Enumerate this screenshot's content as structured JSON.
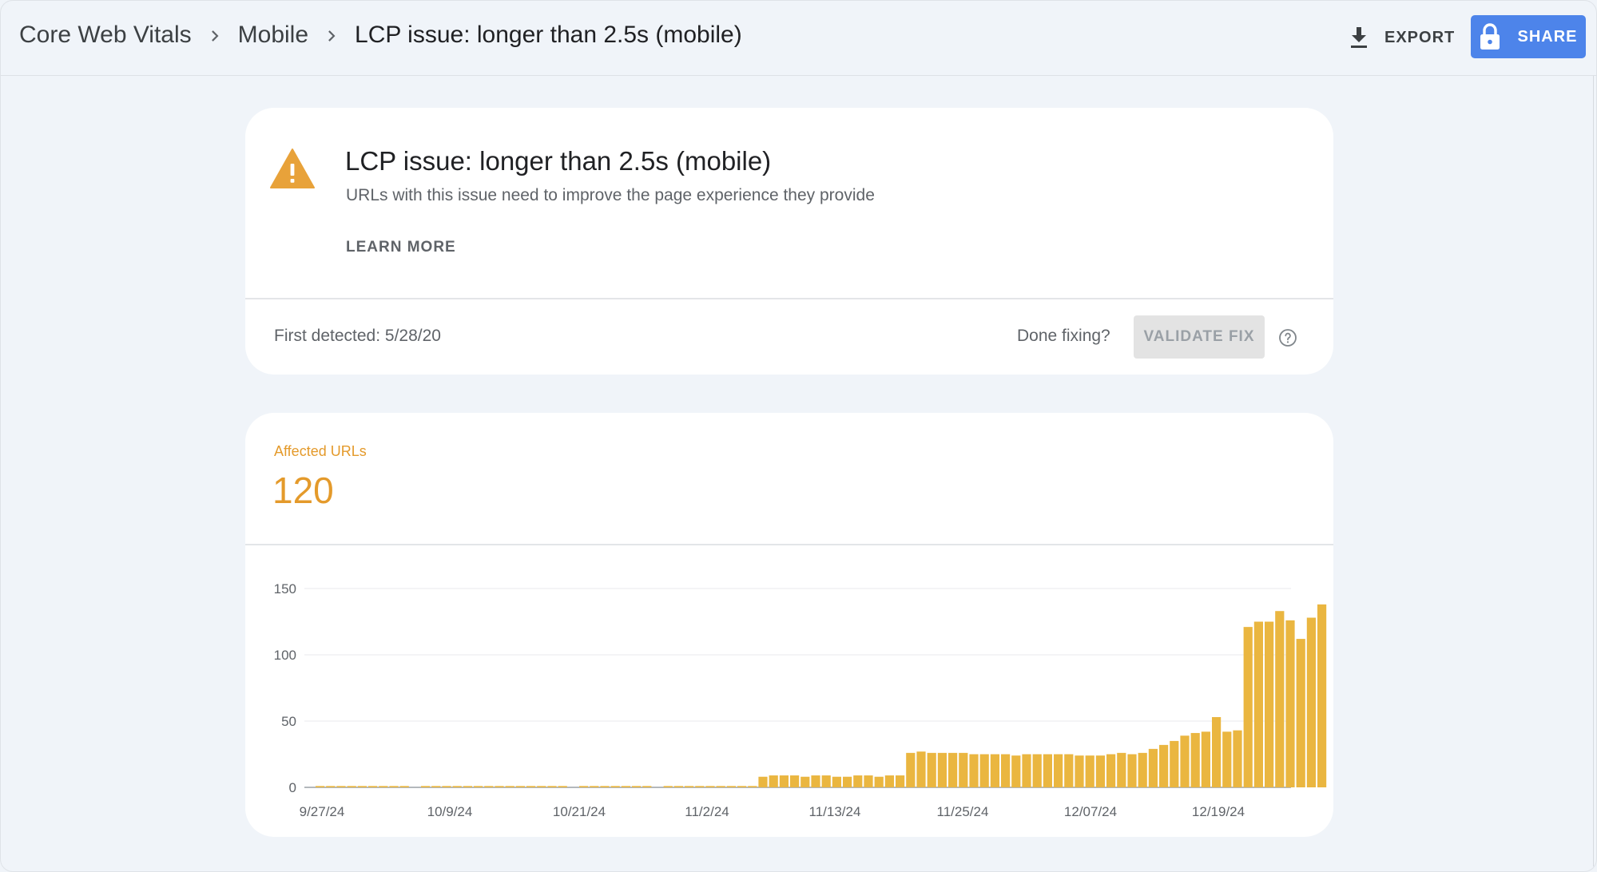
{
  "breadcrumbs": [
    "Core Web Vitals",
    "Mobile",
    "LCP issue: longer than 2.5s (mobile)"
  ],
  "toolbar": {
    "export_label": "EXPORT",
    "share_label": "SHARE"
  },
  "issue": {
    "title": "LCP issue: longer than 2.5s (mobile)",
    "description": "URLs with this issue need to improve the page experience they provide",
    "learn_more_label": "LEARN MORE",
    "first_detected": "First detected: 5/28/20",
    "done_fixing_label": "Done fixing?",
    "validate_fix_label": "VALIDATE FIX"
  },
  "summary": {
    "label": "Affected URLs",
    "value": "120"
  },
  "colors": {
    "warning": "#e8a23a",
    "accent_orange": "#e49a2b",
    "bar": "#eab640",
    "share_button": "#4d84ea"
  },
  "chart_data": {
    "type": "bar",
    "ylim": [
      0,
      150
    ],
    "yticks": [
      0,
      50,
      100,
      150
    ],
    "xtick_labels": [
      "9/27/24",
      "10/9/24",
      "10/21/24",
      "11/2/24",
      "11/13/24",
      "11/25/24",
      "12/07/24",
      "12/19/24"
    ],
    "x_start": "9/27/24",
    "values": [
      1,
      1,
      1,
      1,
      1,
      1,
      1,
      1,
      1,
      0,
      1,
      1,
      1,
      1,
      1,
      1,
      1,
      1,
      1,
      1,
      1,
      1,
      1,
      1,
      0,
      1,
      1,
      1,
      1,
      1,
      1,
      1,
      0,
      1,
      1,
      1,
      1,
      1,
      1,
      1,
      1,
      1,
      8,
      9,
      9,
      9,
      8,
      9,
      9,
      8,
      8,
      9,
      9,
      8,
      9,
      9,
      26,
      27,
      26,
      26,
      26,
      26,
      25,
      25,
      25,
      25,
      24,
      25,
      25,
      25,
      25,
      25,
      24,
      24,
      24,
      25,
      26,
      25,
      26,
      29,
      32,
      35,
      39,
      41,
      42,
      53,
      42,
      43,
      121,
      125,
      125,
      133,
      126,
      112,
      128,
      138
    ]
  }
}
